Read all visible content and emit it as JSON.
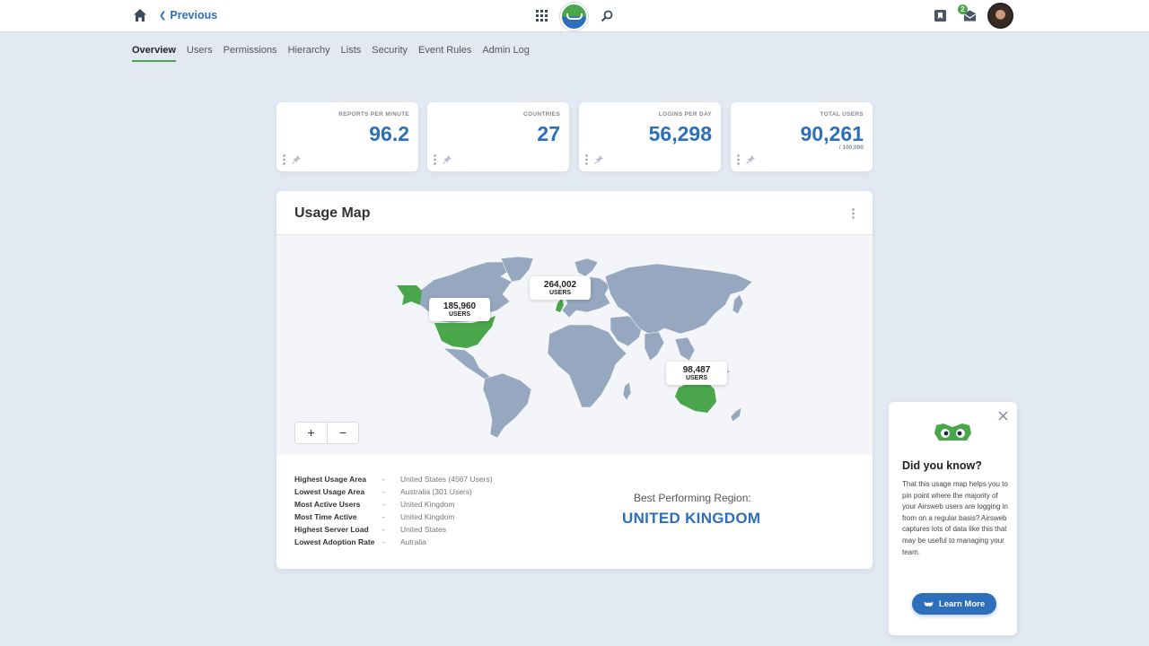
{
  "header": {
    "previous_label": "Previous",
    "mail_badge": "2",
    "icons": [
      "home-icon",
      "apps-grid-icon",
      "logo",
      "search-icon",
      "bookmark-icon",
      "mail-icon",
      "avatar"
    ]
  },
  "tabs": [
    {
      "label": "Overview",
      "active": true
    },
    {
      "label": "Users"
    },
    {
      "label": "Permissions"
    },
    {
      "label": "Hierarchy"
    },
    {
      "label": "Lists"
    },
    {
      "label": "Security"
    },
    {
      "label": "Event Rules"
    },
    {
      "label": "Admin Log"
    }
  ],
  "cards": [
    {
      "label": "REPORTS PER MINUTE",
      "value": "96.2",
      "sub": ""
    },
    {
      "label": "COUNTRIES",
      "value": "27",
      "sub": ""
    },
    {
      "label": "LOGINS PER DAY",
      "value": "56,298",
      "sub": ""
    },
    {
      "label": "TOTAL USERS",
      "value": "90,261",
      "sub": "/ 100,000"
    }
  ],
  "usage_map": {
    "title": "Usage Map",
    "tooltips": [
      {
        "number": "185,960",
        "unit": "USERS"
      },
      {
        "number": "264,002",
        "unit": "USERS"
      },
      {
        "number": "98,487",
        "unit": "USERS"
      }
    ],
    "zoom_in": "+",
    "zoom_out": "−",
    "stats": [
      {
        "key": "Highest Usage Area",
        "dash": "-",
        "value": "United States (4567 Users)"
      },
      {
        "key": "Lowest Usage Area",
        "dash": "-",
        "value": "Australia (301 Users)"
      },
      {
        "key": "Most Active Users",
        "dash": "-",
        "value": "United Kingdom"
      },
      {
        "key": "Most Time Active",
        "dash": "-",
        "value": "United Kingdom"
      },
      {
        "key": "Highest Server Load",
        "dash": "-",
        "value": "United States"
      },
      {
        "key": "Lowest Adoption Rate",
        "dash": "-",
        "value": "Autralia"
      }
    ],
    "best_label": "Best Performing Region:",
    "best_value": "UNITED KINGDOM"
  },
  "did_you_know": {
    "title": "Did you know?",
    "body": "That this usage map helps you to pin point where the majority of your Airsweb users are logging in from on a regular basis? Airsweb captures lots of data like this that may be useful to managing your team.",
    "button": "Learn More"
  },
  "colors": {
    "accent": "#2d6fba",
    "highlight": "#4aa64b",
    "land": "#96a8bf"
  }
}
